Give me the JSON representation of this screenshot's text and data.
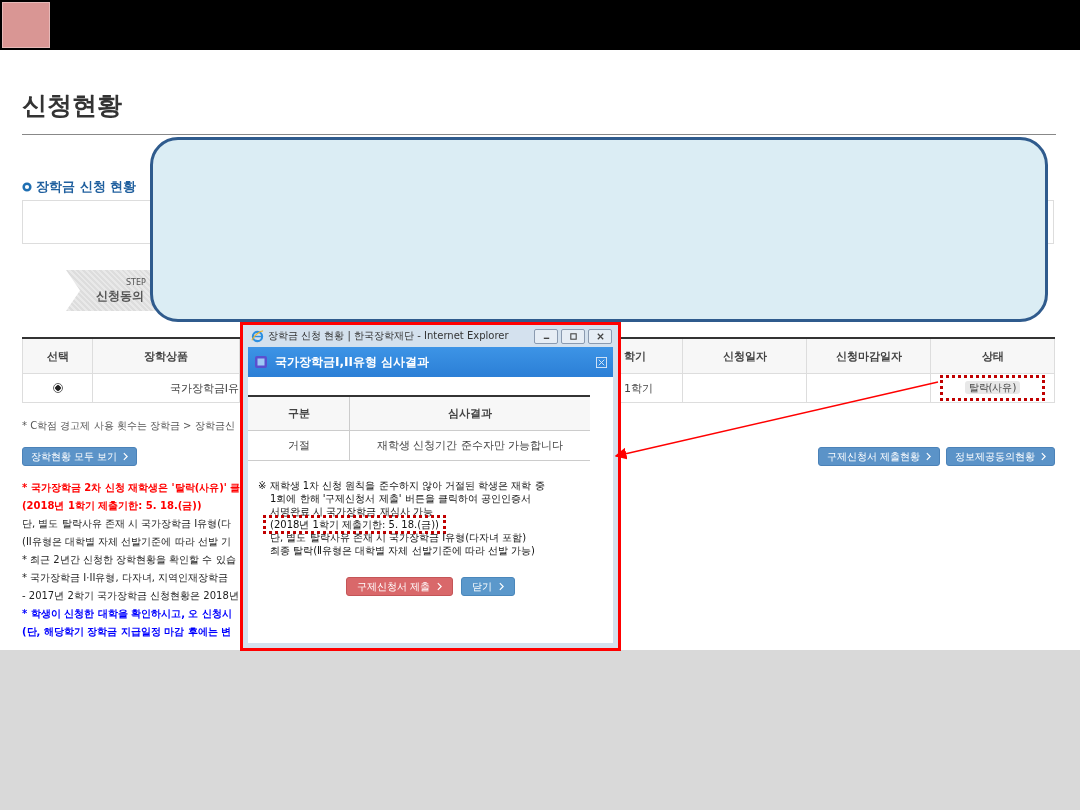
{
  "page_title": "신청현황",
  "section": {
    "title": "장학금 신청 현황"
  },
  "step": {
    "label": "STEP",
    "name": "신청동의"
  },
  "table": {
    "columns": [
      "선택",
      "장학상품",
      "학기",
      "신청일자",
      "신청마감일자",
      "상태"
    ],
    "rows": [
      {
        "selected": true,
        "product": "국가장학금I유",
        "semester": "1학기",
        "applied": "",
        "deadline": "",
        "status": {
          "text": "탈락(사유)",
          "highlighted": true
        }
      }
    ]
  },
  "footnote": "* C학점 경고제 사용 횟수는 장학금 > 장학금신",
  "view_all_button": "장학현황 모두 보기",
  "right_buttons": [
    "구제신청서 제출현황",
    "정보제공동의현황"
  ],
  "notes": [
    {
      "text": "* 국가장학금 2차 신청 재학생은 '탈락(사유)' 클",
      "kind": "warning"
    },
    {
      "text": "(2018년 1학기 제출기한: 5. 18.(금))",
      "kind": "warning"
    },
    {
      "text": "단, 별도 탈락사유 존재 시 국가장학금 I유형(다",
      "kind": "plain"
    },
    {
      "text": "(II유형은 대학별 자체 선발기준에 따라 선발 기",
      "kind": "plain"
    },
    {
      "text": "* 최근 2년간 신청한 장학현황을 확인할 수 있습",
      "kind": "plain"
    },
    {
      "text": "* 국가장학금 I·II유형, 다자녀, 지역인재장학금",
      "kind": "plain"
    },
    {
      "text": "- 2017년 2학기 국가장학금 신청현황은 2018년",
      "kind": "plain"
    },
    {
      "text": "* 학생이 신청한 대학을 확인하시고, 오 신청시",
      "kind": "info"
    },
    {
      "text": "(단, 해당학기 장학금 지급일정 마감 후에는 변",
      "kind": "info"
    }
  ],
  "popup": {
    "window_title": "장학금 신청 현황 | 한국장학재단 - Internet Explorer",
    "dialog_title": "국가장학금I,II유형 심사결과",
    "columns": [
      "구분",
      "심사결과"
    ],
    "row": [
      "거절",
      "재학생 신청기간 준수자만 가능합니다"
    ],
    "note_lines": [
      {
        "text": "※ 재학생 1차 신청 원칙을 준수하지 않아 거절된 학생은 재학 중",
        "highlighted": false
      },
      {
        "text": "1회에 한해 '구제신청서 제출' 버튼을 클릭하여 공인인증서",
        "highlighted": false
      },
      {
        "text": "서명완료 시 국가장학금 재심사 가능",
        "highlighted": false
      },
      {
        "text": "(2018년 1학기 제출기한: 5. 18.(금))",
        "highlighted": true
      },
      {
        "text": "단, 별도 탈락사유 존재 시 국가장학금 Ⅰ유형(다자녀 포함)",
        "highlighted": false
      },
      {
        "text": "최종 탈락(Ⅱ유형은 대학별 자체 선발기준에 따라 선발 가능)",
        "highlighted": false
      }
    ],
    "buttons": [
      {
        "label": "구제신청서 제출",
        "kind": "danger"
      },
      {
        "label": "닫기",
        "kind": "primary"
      }
    ]
  }
}
